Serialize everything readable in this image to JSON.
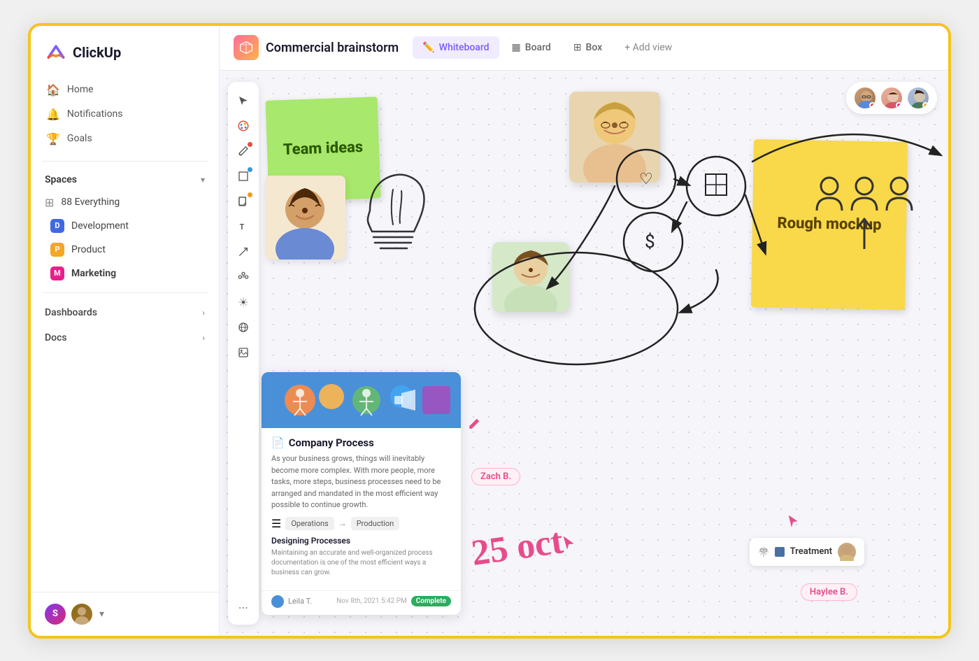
{
  "app": {
    "logo_text": "ClickUp"
  },
  "sidebar": {
    "nav": [
      {
        "id": "home",
        "label": "Home",
        "icon": "🏠"
      },
      {
        "id": "notifications",
        "label": "Notifications",
        "icon": "🔔"
      },
      {
        "id": "goals",
        "label": "Goals",
        "icon": "🏆"
      }
    ],
    "spaces_label": "Spaces",
    "spaces_chevron": "▾",
    "everything_label": "88 Everything",
    "spaces": [
      {
        "id": "development",
        "label": "Development",
        "badge": "D",
        "color": "badge-blue"
      },
      {
        "id": "product",
        "label": "Product",
        "badge": "P",
        "color": "badge-orange"
      },
      {
        "id": "marketing",
        "label": "Marketing",
        "badge": "M",
        "color": "badge-pink",
        "bold": true
      }
    ],
    "sections": [
      {
        "id": "dashboards",
        "label": "Dashboards",
        "chevron": "›"
      },
      {
        "id": "docs",
        "label": "Docs",
        "chevron": "›"
      }
    ]
  },
  "header": {
    "icon_emoji": "🎁",
    "title": "Commercial brainstorm",
    "tabs": [
      {
        "id": "whiteboard",
        "label": "Whiteboard",
        "icon": "✏️",
        "active": true
      },
      {
        "id": "board",
        "label": "Board",
        "icon": "▦"
      },
      {
        "id": "box",
        "label": "Box",
        "icon": "⊞"
      },
      {
        "id": "add_view",
        "label": "+ Add view"
      }
    ]
  },
  "toolbar": {
    "tools": [
      {
        "id": "cursor",
        "icon": "↗",
        "dot": ""
      },
      {
        "id": "palette",
        "icon": "🎨",
        "dot": ""
      },
      {
        "id": "pen",
        "icon": "✏",
        "dot": "dot-red"
      },
      {
        "id": "rect",
        "icon": "□",
        "dot": "dot-blue"
      },
      {
        "id": "note",
        "icon": "🗒",
        "dot": "dot-orange"
      },
      {
        "id": "text",
        "icon": "T",
        "dot": ""
      },
      {
        "id": "arrow",
        "icon": "⤴",
        "dot": ""
      },
      {
        "id": "connect",
        "icon": "⦿",
        "dot": ""
      },
      {
        "id": "sparkle",
        "icon": "✦",
        "dot": ""
      },
      {
        "id": "globe",
        "icon": "🌐",
        "dot": ""
      },
      {
        "id": "image",
        "icon": "🖼",
        "dot": ""
      }
    ],
    "more_label": "..."
  },
  "whiteboard": {
    "sticky_green_text": "Team ideas",
    "sticky_yellow_text": "Rough mockup",
    "doc_title": "Company Process",
    "doc_desc": "As your business grows, things will inevitably become more complex. With more people, more tasks, more steps, business processes need to be arranged and mandated in the most efficient way possible to continue growth.",
    "doc_flow_from": "Operations",
    "doc_flow_to": "Production",
    "doc_sub": "Designing Processes",
    "doc_sub_desc": "Maintaining an accurate and well-organized process documentation is one of the most efficient ways a business can grow.",
    "doc_author": "Leila T.",
    "doc_date": "Nov 8th, 2021 5:42 PM",
    "doc_status": "Complete",
    "label_zach": "Zach B.",
    "label_haylee": "Haylee B.",
    "treatment_label": "Treatment",
    "date_text": "25 oct"
  },
  "users": [
    {
      "id": "u1",
      "dot_color": "#e74c3c"
    },
    {
      "id": "u2",
      "dot_color": "#e91e8c"
    },
    {
      "id": "u3",
      "dot_color": "#f5a623"
    }
  ]
}
